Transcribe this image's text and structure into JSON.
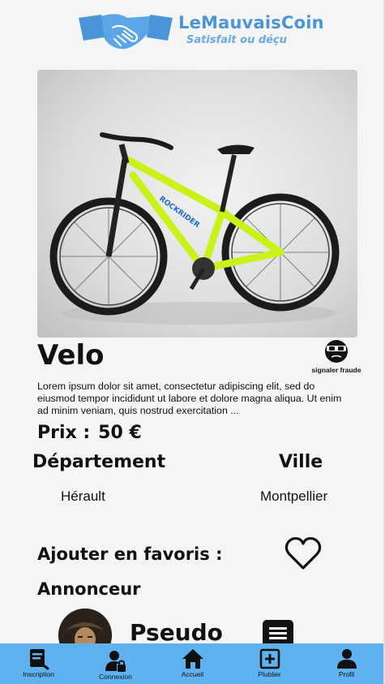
{
  "header": {
    "brand": "LeMauvaisCoin",
    "tagline": "Satisfait ou déçu",
    "logo_icon": "handshake-icon"
  },
  "listing": {
    "title": "Velo",
    "fraud_label": "signaler fraude",
    "fraud_icon": "bandit-mask-icon",
    "description": "Lorem ipsum dolor sit amet, consectetur adipiscing elit, sed do eiusmod tempor incididunt ut labore et dolore magna aliqua. Ut enim ad minim veniam, quis nostrud exercitation  ...",
    "price_label": "Prix :",
    "price_value": "50 €",
    "department_label": "Département",
    "department_value": "Hérault",
    "city_label": "Ville",
    "city_value": "Montpellier",
    "favorite_label": "Ajouter en favoris :",
    "favorite_icon": "heart-icon"
  },
  "announcer": {
    "heading": "Annonceur",
    "pseudo": "Pseudo",
    "message_icon": "message-icon"
  },
  "nav": {
    "items": [
      {
        "label": "Inscription",
        "icon": "register-form-icon"
      },
      {
        "label": "Connexion",
        "icon": "user-lock-icon"
      },
      {
        "label": "Accueil",
        "icon": "home-icon"
      },
      {
        "label": "Plublier",
        "icon": "plus-square-icon"
      },
      {
        "label": "Profil",
        "icon": "user-icon"
      }
    ]
  },
  "colors": {
    "brand": "#4a95d8",
    "nav_bg": "#5eb2ef",
    "bike": "#c8f21a"
  }
}
